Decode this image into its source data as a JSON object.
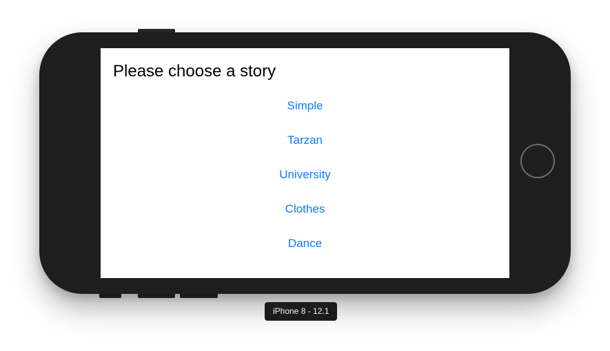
{
  "screen": {
    "title": "Please choose a story",
    "stories": [
      {
        "label": "Simple"
      },
      {
        "label": "Tarzan"
      },
      {
        "label": "University"
      },
      {
        "label": "Clothes"
      },
      {
        "label": "Dance"
      }
    ],
    "link_color": "#0a7aff"
  },
  "simulator": {
    "device_label": "iPhone 8 - 12.1",
    "home_button_icon": "home-button-ring"
  }
}
